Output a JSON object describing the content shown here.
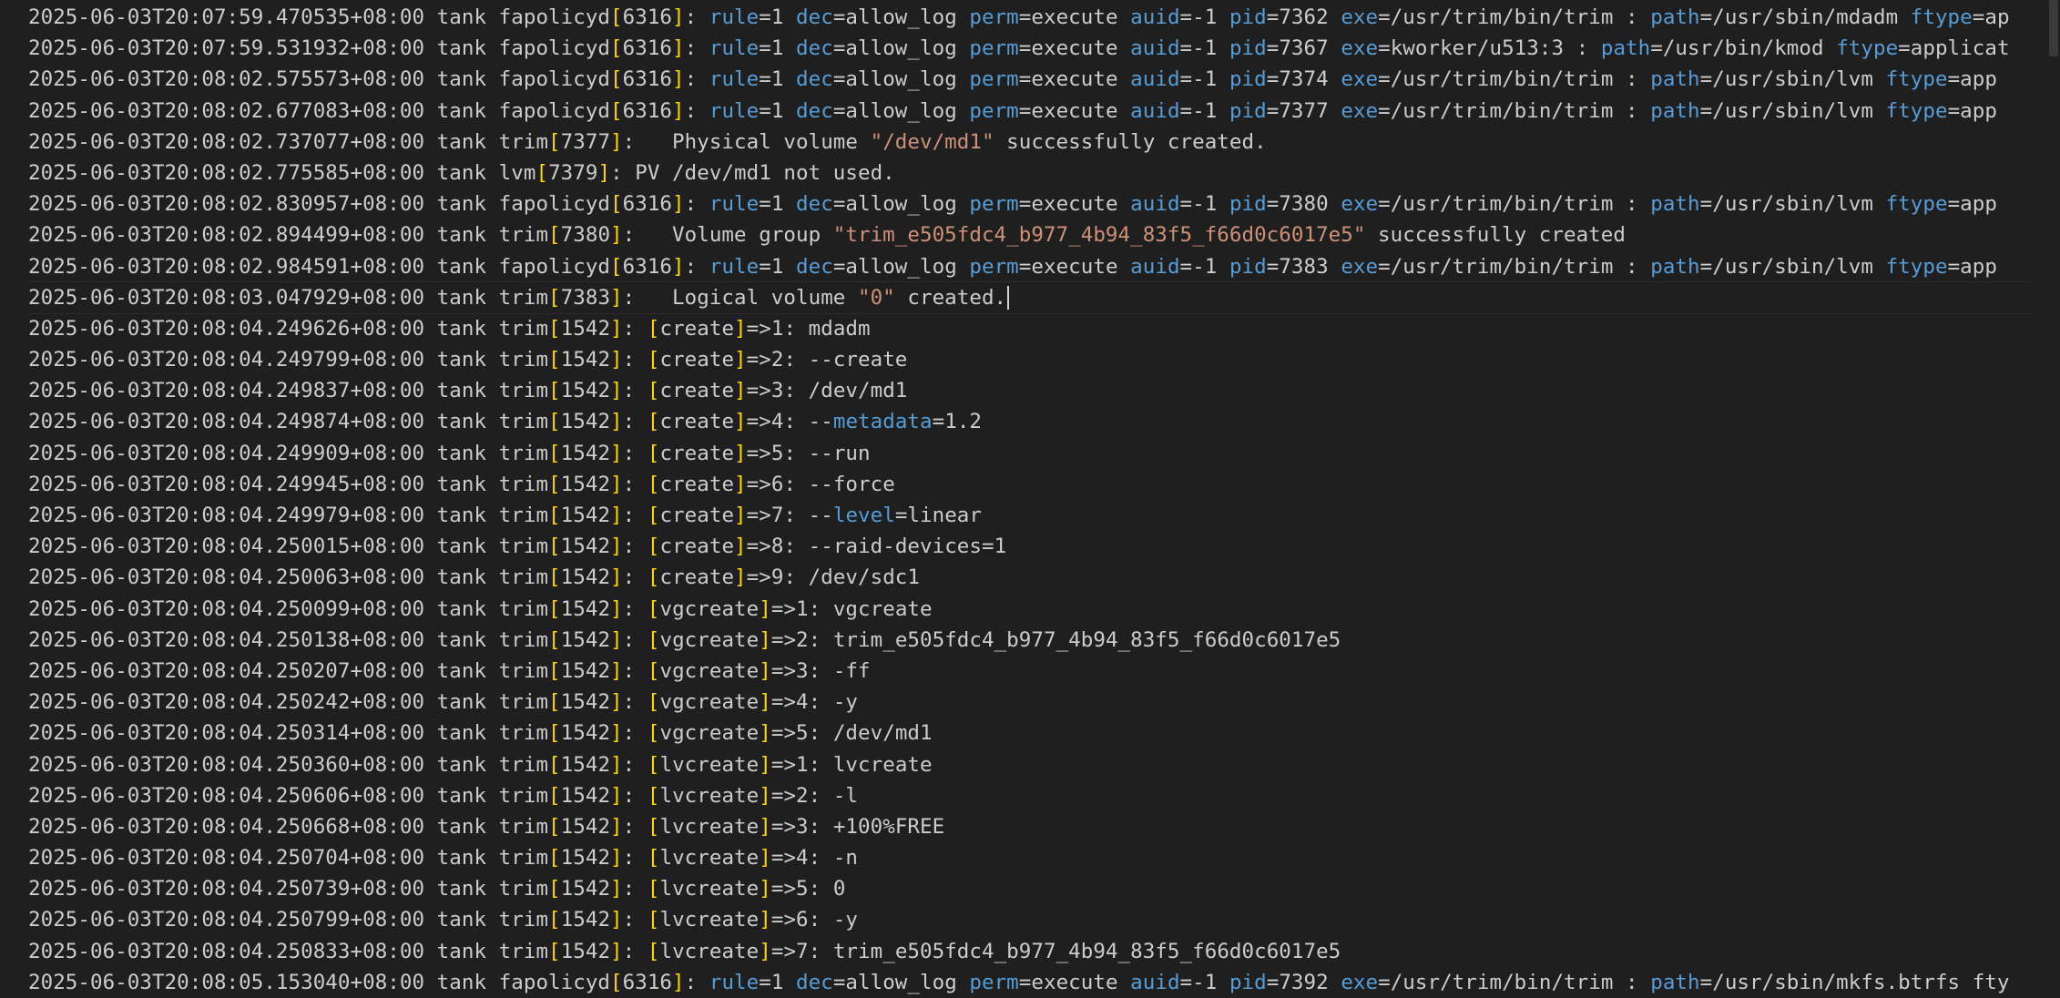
{
  "editor": {
    "lines": [
      "2025-06-03T20:07:59.470535+08:00 tank fapolicyd[6316]: rule=1 dec=allow_log perm=execute auid=-1 pid=7362 exe=/usr/trim/bin/trim : path=/usr/sbin/mdadm ftype=ap",
      "2025-06-03T20:07:59.531932+08:00 tank fapolicyd[6316]: rule=1 dec=allow_log perm=execute auid=-1 pid=7367 exe=kworker/u513:3 : path=/usr/bin/kmod ftype=applicat",
      "2025-06-03T20:08:02.575573+08:00 tank fapolicyd[6316]: rule=1 dec=allow_log perm=execute auid=-1 pid=7374 exe=/usr/trim/bin/trim : path=/usr/sbin/lvm ftype=app",
      "2025-06-03T20:08:02.677083+08:00 tank fapolicyd[6316]: rule=1 dec=allow_log perm=execute auid=-1 pid=7377 exe=/usr/trim/bin/trim : path=/usr/sbin/lvm ftype=app",
      "2025-06-03T20:08:02.737077+08:00 tank trim[7377]:   Physical volume \"/dev/md1\" successfully created.",
      "2025-06-03T20:08:02.775585+08:00 tank lvm[7379]: PV /dev/md1 not used.",
      "2025-06-03T20:08:02.830957+08:00 tank fapolicyd[6316]: rule=1 dec=allow_log perm=execute auid=-1 pid=7380 exe=/usr/trim/bin/trim : path=/usr/sbin/lvm ftype=app",
      "2025-06-03T20:08:02.894499+08:00 tank trim[7380]:   Volume group \"trim_e505fdc4_b977_4b94_83f5_f66d0c6017e5\" successfully created",
      "2025-06-03T20:08:02.984591+08:00 tank fapolicyd[6316]: rule=1 dec=allow_log perm=execute auid=-1 pid=7383 exe=/usr/trim/bin/trim : path=/usr/sbin/lvm ftype=app",
      "2025-06-03T20:08:03.047929+08:00 tank trim[7383]:   Logical volume \"0\" created.",
      "2025-06-03T20:08:04.249626+08:00 tank trim[1542]: [create]=>1: mdadm",
      "2025-06-03T20:08:04.249799+08:00 tank trim[1542]: [create]=>2: --create",
      "2025-06-03T20:08:04.249837+08:00 tank trim[1542]: [create]=>3: /dev/md1",
      "2025-06-03T20:08:04.249874+08:00 tank trim[1542]: [create]=>4: --metadata=1.2",
      "2025-06-03T20:08:04.249909+08:00 tank trim[1542]: [create]=>5: --run",
      "2025-06-03T20:08:04.249945+08:00 tank trim[1542]: [create]=>6: --force",
      "2025-06-03T20:08:04.249979+08:00 tank trim[1542]: [create]=>7: --level=linear",
      "2025-06-03T20:08:04.250015+08:00 tank trim[1542]: [create]=>8: --raid-devices=1",
      "2025-06-03T20:08:04.250063+08:00 tank trim[1542]: [create]=>9: /dev/sdc1",
      "2025-06-03T20:08:04.250099+08:00 tank trim[1542]: [vgcreate]=>1: vgcreate",
      "2025-06-03T20:08:04.250138+08:00 tank trim[1542]: [vgcreate]=>2: trim_e505fdc4_b977_4b94_83f5_f66d0c6017e5",
      "2025-06-03T20:08:04.250207+08:00 tank trim[1542]: [vgcreate]=>3: -ff",
      "2025-06-03T20:08:04.250242+08:00 tank trim[1542]: [vgcreate]=>4: -y",
      "2025-06-03T20:08:04.250314+08:00 tank trim[1542]: [vgcreate]=>5: /dev/md1",
      "2025-06-03T20:08:04.250360+08:00 tank trim[1542]: [lvcreate]=>1: lvcreate",
      "2025-06-03T20:08:04.250606+08:00 tank trim[1542]: [lvcreate]=>2: -l",
      "2025-06-03T20:08:04.250668+08:00 tank trim[1542]: [lvcreate]=>3: +100%FREE",
      "2025-06-03T20:08:04.250704+08:00 tank trim[1542]: [lvcreate]=>4: -n",
      "2025-06-03T20:08:04.250739+08:00 tank trim[1542]: [lvcreate]=>5: 0",
      "2025-06-03T20:08:04.250799+08:00 tank trim[1542]: [lvcreate]=>6: -y",
      "2025-06-03T20:08:04.250833+08:00 tank trim[1542]: [lvcreate]=>7: trim_e505fdc4_b977_4b94_83f5_f66d0c6017e5",
      "2025-06-03T20:08:05.153040+08:00 tank fapolicyd[6316]: rule=1 dec=allow_log perm=execute auid=-1 pid=7392 exe=/usr/trim/bin/trim : path=/usr/sbin/mkfs.btrfs fty"
    ],
    "cursor_line": 10
  },
  "colors": {
    "background": "#1f1f1f",
    "text": "#cccccc",
    "keyword": "#569cd6",
    "bracket": "#ffd700",
    "string": "#ce9178"
  }
}
